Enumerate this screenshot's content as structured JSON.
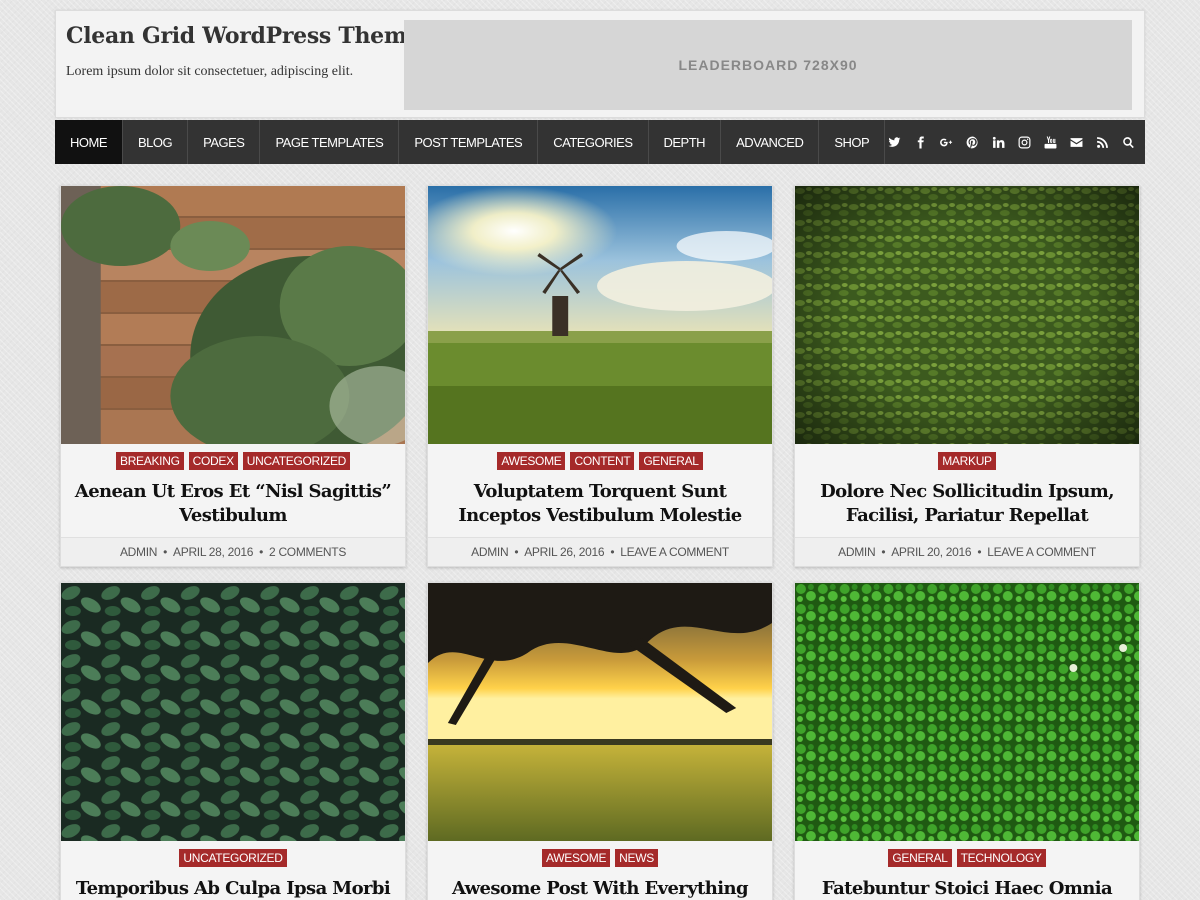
{
  "header": {
    "site_title": "Clean Grid WordPress Theme",
    "site_description": "Lorem ipsum dolor sit consectetuer, adipiscing elit.",
    "leaderboard": "LEADERBOARD 728X90"
  },
  "nav": {
    "items": [
      {
        "label": "HOME",
        "active": true
      },
      {
        "label": "BLOG"
      },
      {
        "label": "PAGES"
      },
      {
        "label": "PAGE TEMPLATES"
      },
      {
        "label": "POST TEMPLATES"
      },
      {
        "label": "CATEGORIES"
      },
      {
        "label": "DEPTH"
      },
      {
        "label": "ADVANCED"
      },
      {
        "label": "SHOP"
      }
    ],
    "social_icons": [
      "twitter-icon",
      "facebook-icon",
      "google-plus-icon",
      "pinterest-icon",
      "linkedin-icon",
      "instagram-icon",
      "youtube-icon",
      "email-icon",
      "rss-icon",
      "search-icon"
    ]
  },
  "colors": {
    "nav_bg": "#333333",
    "nav_active_bg": "#111111",
    "category_badge": "#a52a2a",
    "page_bg": "#e6e6e6"
  },
  "posts": [
    {
      "categories": [
        "BREAKING",
        "CODEX",
        "UNCATEGORIZED"
      ],
      "title": "Aenean Ut Eros Et “Nisl Sagittis” Vestibulum",
      "author": "ADMIN",
      "date": "APRIL 28, 2016",
      "comments": "2 COMMENTS"
    },
    {
      "categories": [
        "AWESOME",
        "CONTENT",
        "GENERAL"
      ],
      "title": "Voluptatem Torquent Sunt Inceptos Vestibulum Molestie",
      "author": "ADMIN",
      "date": "APRIL 26, 2016",
      "comments": "LEAVE A COMMENT"
    },
    {
      "categories": [
        "MARKUP"
      ],
      "title": "Dolore Nec Sollicitudin Ipsum, Facilisi, Pariatur Repellat",
      "author": "ADMIN",
      "date": "APRIL 20, 2016",
      "comments": "LEAVE A COMMENT"
    },
    {
      "categories": [
        "UNCATEGORIZED"
      ],
      "title": "Temporibus Ab Culpa Ipsa Morbi",
      "author": "",
      "date": "",
      "comments": ""
    },
    {
      "categories": [
        "AWESOME",
        "NEWS"
      ],
      "title": "Awesome Post With Everything With It",
      "author": "",
      "date": "",
      "comments": ""
    },
    {
      "categories": [
        "GENERAL",
        "TECHNOLOGY"
      ],
      "title": "Fatebuntur Stoici Haec Omnia Dicta",
      "author": "",
      "date": "",
      "comments": ""
    }
  ]
}
